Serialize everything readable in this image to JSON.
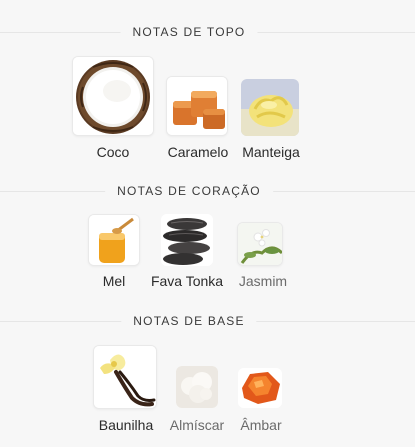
{
  "sections": [
    {
      "title": "NOTAS DE TOPO",
      "notes": [
        {
          "label": "Coco",
          "image": "coconut-icon"
        },
        {
          "label": "Caramelo",
          "image": "caramel-icon"
        },
        {
          "label": "Manteiga",
          "image": "butter-icon"
        }
      ]
    },
    {
      "title": "NOTAS DE CORAÇÃO",
      "notes": [
        {
          "label": "Mel",
          "image": "honey-icon"
        },
        {
          "label": "Fava Tonka",
          "image": "tonka-bean-icon"
        },
        {
          "label": "Jasmim",
          "image": "jasmine-icon"
        }
      ]
    },
    {
      "title": "NOTAS DE BASE",
      "notes": [
        {
          "label": "Baunilha",
          "image": "vanilla-icon"
        },
        {
          "label": "Almíscar",
          "image": "musk-icon"
        },
        {
          "label": "Âmbar",
          "image": "amber-icon"
        }
      ]
    }
  ]
}
